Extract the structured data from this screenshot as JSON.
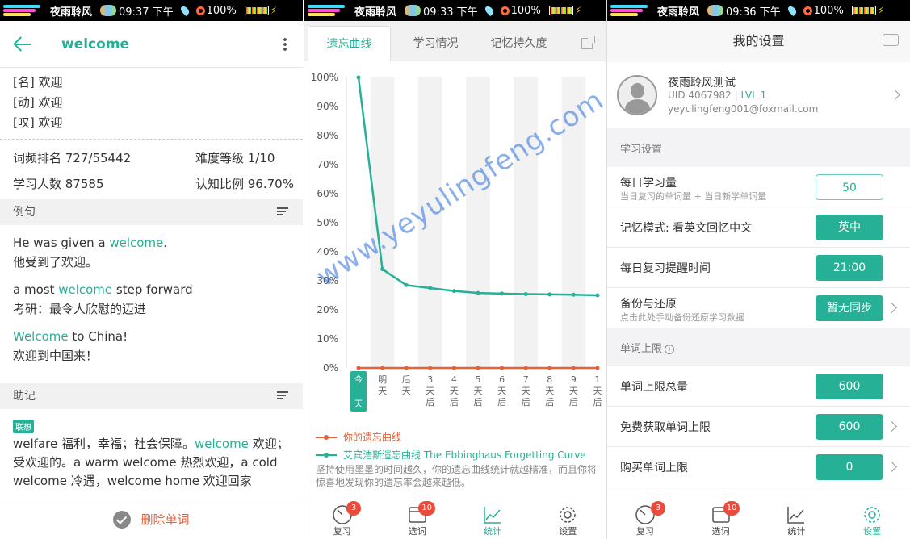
{
  "status_bar": [
    {
      "app": "夜雨聆风",
      "time": "09:37 下午",
      "battery": "100%"
    },
    {
      "app": "夜雨聆风",
      "time": "09:33 下午",
      "battery": "100%"
    },
    {
      "app": "夜雨聆风",
      "time": "09:36 下午",
      "battery": "100%"
    }
  ],
  "word": {
    "title": "welcome",
    "definitions": [
      "[名] 欢迎",
      "[动] 欢迎",
      "[叹] 欢迎"
    ],
    "freq_rank": "词频排名 727/55442",
    "difficulty": "难度等级 1/10",
    "learners": "学习人数 87585",
    "recognition": "认知比例 96.70%",
    "examples_title": "例句",
    "examples": [
      {
        "before": "He was given a ",
        "hl": "welcome",
        "after": ".",
        "zh": "他受到了欢迎。"
      },
      {
        "before": "a most ",
        "hl": "welcome",
        "after": " step forward",
        "zh": "考研：最令人欣慰的迈进"
      },
      {
        "before": "",
        "hl": "Welcome",
        "after": " to China!",
        "zh": "欢迎到中国来！"
      }
    ],
    "mnemonic_title": "助记",
    "mnemonic_tag": "联想",
    "mnemonic_before": "welfare 福利，幸福；社会保障。",
    "mnemonic_hl": "welcome",
    "mnemonic_after": " 欢迎；受欢迎的。a warm welcome 热烈欢迎，a cold welcome 冷遇，welcome home 欢迎回家",
    "delete_label": "删除单词"
  },
  "stats": {
    "tabs": [
      "遗忘曲线",
      "学习情况",
      "记忆持久度"
    ],
    "legend_user": "你的遗忘曲线",
    "legend_ebb": "艾宾浩斯遗忘曲线 The Ebbinghaus Forgetting Curve",
    "note": "坚持使用墨墨的时间越久，你的遗忘曲线统计就越精准，而且你将惊喜地发现你的遗忘率会越来越低。",
    "watermark": "www.yeyulingfeng.com"
  },
  "chart_data": {
    "type": "line",
    "categories": [
      "今天",
      "明天",
      "后天",
      "3天后",
      "4天后",
      "5天后",
      "6天后",
      "7天后",
      "8天后",
      "9天后",
      "1天后"
    ],
    "ylim": [
      0,
      100
    ],
    "yticks": [
      "0%",
      "10%",
      "20%",
      "30%",
      "40%",
      "50%",
      "60%",
      "70%",
      "80%",
      "90%",
      "100%"
    ],
    "series": [
      {
        "name": "你的遗忘曲线",
        "color": "#e2623c",
        "values": [
          0,
          0,
          0,
          0,
          0,
          0,
          0,
          0,
          0,
          0,
          0
        ]
      },
      {
        "name": "艾宾浩斯遗忘曲线 The Ebbinghaus Forgetting Curve",
        "color": "#26b196",
        "values": [
          100,
          34,
          28.5,
          27.5,
          26.5,
          25.8,
          25.6,
          25.4,
          25.3,
          25.2,
          25
        ]
      }
    ],
    "grid": "alternating-columns",
    "highlight_category": "今天",
    "accent": "#26b196"
  },
  "nav": [
    {
      "label": "复习",
      "badge": "3"
    },
    {
      "label": "选词",
      "badge": "10"
    },
    {
      "label": "统计",
      "badge": ""
    },
    {
      "label": "设置",
      "badge": ""
    }
  ],
  "settings": {
    "title": "我的设置",
    "profile_name": "夜雨聆风测试",
    "uid": "UID 4067982",
    "lvl": "LVL 1",
    "email": "yeyulingfeng001@foxmail.com",
    "group_study": "学习设置",
    "daily_label": "每日学习量",
    "daily_sub": "当日复习的单词量 + 当日新学单词量",
    "daily_value": "50",
    "memory_label": "记忆模式: 看英文回忆中文",
    "memory_value": "英中",
    "remind_label": "每日复习提醒时间",
    "remind_value": "21:00",
    "backup_label": "备份与还原",
    "backup_sub": "点击此处手动备份还原学习数据",
    "backup_value": "暂无同步",
    "group_limit": "单词上限",
    "total_label": "单词上限总量",
    "total_value": "600",
    "free_label": "免费获取单词上限",
    "free_value": "600",
    "buy_label": "购买单词上限",
    "buy_value": "0"
  },
  "colors": {
    "accent": "#26b196",
    "danger": "#e2623c",
    "badge": "#e94b3c"
  }
}
